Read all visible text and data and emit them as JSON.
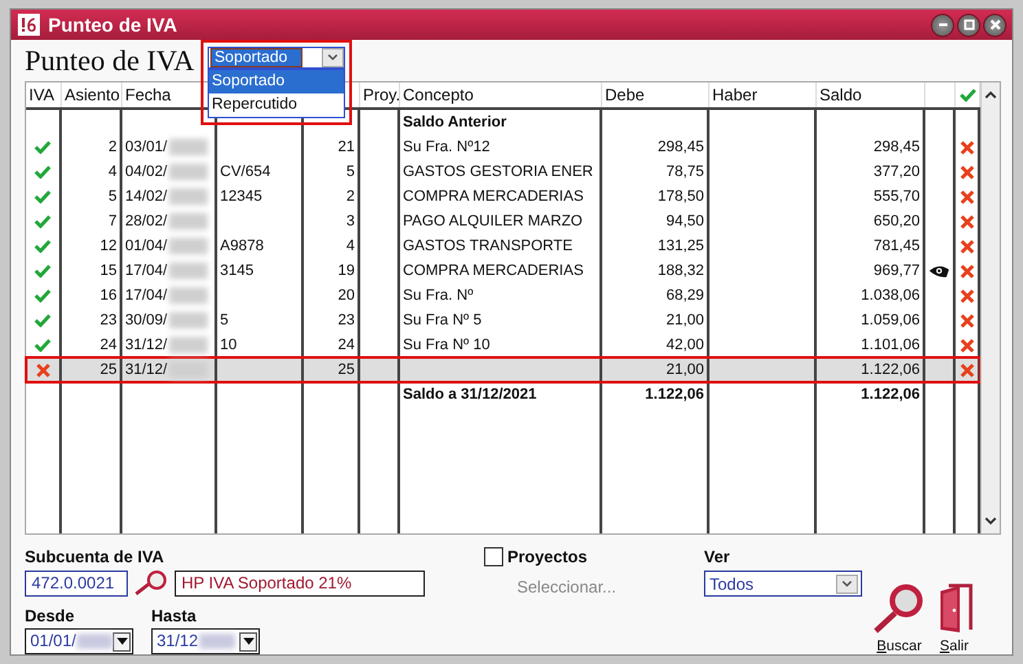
{
  "window": {
    "title": "Punteo de IVA"
  },
  "heading": "Punteo de IVA",
  "type_dropdown": {
    "value": "Soportado",
    "expanded": true,
    "options": [
      {
        "label": "Soportado",
        "selected": true
      },
      {
        "label": "Repercutido",
        "selected": false
      }
    ]
  },
  "table": {
    "headers": {
      "iva": "IVA",
      "asiento": "Asiento",
      "fecha": "Fecha",
      "proy": "Proy.",
      "concepto": "Concepto",
      "debe": "Debe",
      "haber": "Haber",
      "saldo": "Saldo"
    },
    "rows": [
      {
        "kind": "balance",
        "concepto": "Saldo Anterior"
      },
      {
        "kind": "entry",
        "iva_checked": true,
        "asiento": "2",
        "fecha": "03/01/",
        "document": "",
        "number": "21",
        "concepto": "Su Fra. Nº12",
        "debe": "298,45",
        "saldo": "298,45",
        "viewed": false,
        "selected": false
      },
      {
        "kind": "entry",
        "iva_checked": true,
        "asiento": "4",
        "fecha": "04/02/",
        "document": "CV/654",
        "number": "5",
        "concepto": "GASTOS GESTORIA ENER",
        "debe": "78,75",
        "saldo": "377,20",
        "viewed": false,
        "selected": false
      },
      {
        "kind": "entry",
        "iva_checked": true,
        "asiento": "5",
        "fecha": "14/02/",
        "document": "12345",
        "number": "2",
        "concepto": "COMPRA MERCADERIAS",
        "debe": "178,50",
        "saldo": "555,70",
        "viewed": false,
        "selected": false
      },
      {
        "kind": "entry",
        "iva_checked": true,
        "asiento": "7",
        "fecha": "28/02/",
        "document": "",
        "number": "3",
        "concepto": "PAGO ALQUILER MARZO",
        "debe": "94,50",
        "saldo": "650,20",
        "viewed": false,
        "selected": false
      },
      {
        "kind": "entry",
        "iva_checked": true,
        "asiento": "12",
        "fecha": "01/04/",
        "document": "A9878",
        "number": "4",
        "concepto": "GASTOS TRANSPORTE",
        "debe": "131,25",
        "saldo": "781,45",
        "viewed": false,
        "selected": false
      },
      {
        "kind": "entry",
        "iva_checked": true,
        "asiento": "15",
        "fecha": "17/04/",
        "document": "3145",
        "number": "19",
        "concepto": "COMPRA MERCADERIAS",
        "debe": "188,32",
        "saldo": "969,77",
        "viewed": true,
        "selected": false
      },
      {
        "kind": "entry",
        "iva_checked": true,
        "asiento": "16",
        "fecha": "17/04/",
        "document": "",
        "number": "20",
        "concepto": "Su Fra. Nº",
        "debe": "68,29",
        "saldo": "1.038,06",
        "viewed": false,
        "selected": false
      },
      {
        "kind": "entry",
        "iva_checked": true,
        "asiento": "23",
        "fecha": "30/09/",
        "document": "5",
        "number": "23",
        "concepto": "Su Fra Nº 5",
        "debe": "21,00",
        "saldo": "1.059,06",
        "viewed": false,
        "selected": false
      },
      {
        "kind": "entry",
        "iva_checked": true,
        "asiento": "24",
        "fecha": "31/12/",
        "document": "10",
        "number": "24",
        "concepto": "Su Fra Nº 10",
        "debe": "42,00",
        "saldo": "1.101,06",
        "viewed": false,
        "selected": false
      },
      {
        "kind": "entry",
        "iva_checked": false,
        "asiento": "25",
        "fecha": "31/12/",
        "document": "",
        "number": "25",
        "concepto": "",
        "debe": "21,00",
        "saldo": "1.122,06",
        "viewed": false,
        "selected": true
      },
      {
        "kind": "total",
        "concepto": "Saldo a 31/12/2021",
        "debe": "1.122,06",
        "saldo": "1.122,06"
      }
    ]
  },
  "subcuenta": {
    "label": "Subcuenta de IVA",
    "value": "472.0.0021",
    "description": "HP IVA Soportado 21%"
  },
  "desde": {
    "label": "Desde",
    "value": "01/01/"
  },
  "hasta": {
    "label": "Hasta",
    "value": "31/12"
  },
  "proyectos": {
    "label": "Proyectos",
    "checked": false,
    "placeholder": "Seleccionar..."
  },
  "ver": {
    "label": "Ver",
    "value": "Todos"
  },
  "buttons": [
    {
      "kind": "search",
      "label": "Buscar"
    },
    {
      "kind": "exit",
      "label": "Salir"
    }
  ]
}
